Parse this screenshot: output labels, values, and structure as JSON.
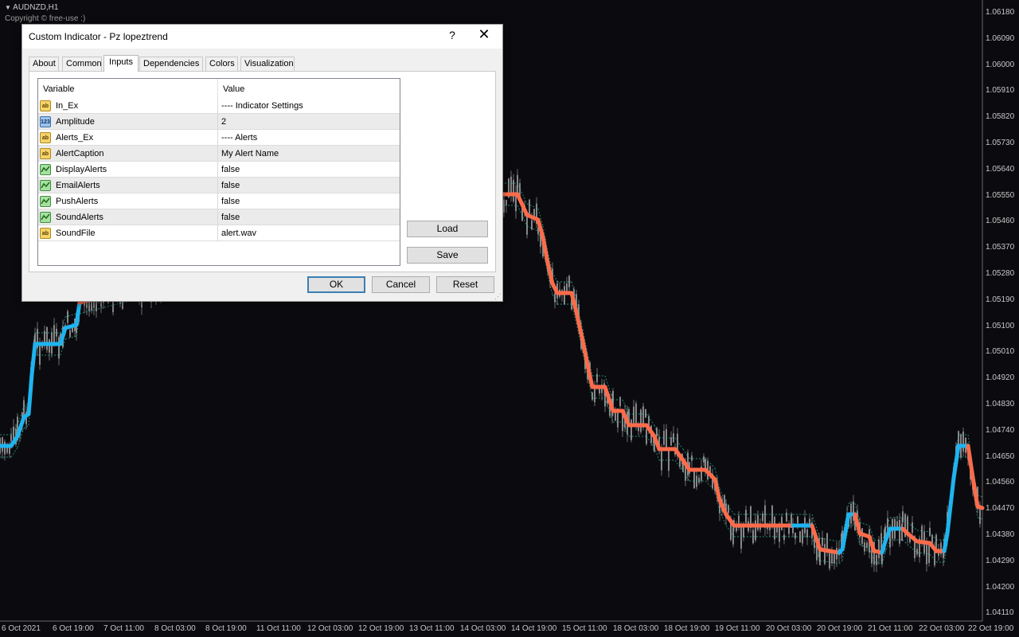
{
  "chart": {
    "symbol_label": "AUDNZD,H1",
    "copyright": "Copyright © free-use :)",
    "y_labels": [
      "1.06180",
      "1.06090",
      "1.06000",
      "1.05910",
      "1.05820",
      "1.05730",
      "1.05640",
      "1.05550",
      "1.05460",
      "1.05370",
      "1.05280",
      "1.05190",
      "1.05100",
      "1.05010",
      "1.04920",
      "1.04830",
      "1.04740",
      "1.04650",
      "1.04560",
      "1.04470",
      "1.04380",
      "1.04290",
      "1.04200",
      "1.04110"
    ],
    "x_labels": [
      "6 Oct 2021",
      "6 Oct 19:00",
      "7 Oct 11:00",
      "8 Oct 03:00",
      "8 Oct 19:00",
      "11 Oct 11:00",
      "12 Oct 03:00",
      "12 Oct 19:00",
      "13 Oct 11:00",
      "14 Oct 03:00",
      "14 Oct 19:00",
      "15 Oct 11:00",
      "18 Oct 03:00",
      "18 Oct 19:00",
      "19 Oct 11:00",
      "20 Oct 03:00",
      "20 Oct 19:00",
      "21 Oct 11:00",
      "22 Oct 03:00",
      "22 Oct 19:00"
    ],
    "colors": {
      "up": "#1eb4f0",
      "down": "#ff6b4a",
      "candles": "#9a9a9a",
      "band": "#2fb8a0"
    }
  },
  "dialog": {
    "title": "Custom Indicator - Pz lopeztrend",
    "help_label": "?",
    "close_label": "✕",
    "tabs": [
      "About",
      "Common",
      "Inputs",
      "Dependencies",
      "Colors",
      "Visualization"
    ],
    "active_tab": "Inputs",
    "grid": {
      "col_variable": "Variable",
      "col_value": "Value",
      "rows": [
        {
          "icon": "ab",
          "variable": "In_Ex",
          "value": "---- Indicator Settings"
        },
        {
          "icon": "123",
          "variable": "Amplitude",
          "value": "2"
        },
        {
          "icon": "ab",
          "variable": "Alerts_Ex",
          "value": "---- Alerts"
        },
        {
          "icon": "ab",
          "variable": "AlertCaption",
          "value": "My Alert Name"
        },
        {
          "icon": "bool",
          "variable": "DisplayAlerts",
          "value": "false"
        },
        {
          "icon": "bool",
          "variable": "EmailAlerts",
          "value": "false"
        },
        {
          "icon": "bool",
          "variable": "PushAlerts",
          "value": "false"
        },
        {
          "icon": "bool",
          "variable": "SoundAlerts",
          "value": "false"
        },
        {
          "icon": "ab",
          "variable": "SoundFile",
          "value": "alert.wav"
        }
      ]
    },
    "load_label": "Load",
    "save_label": "Save",
    "ok_label": "OK",
    "cancel_label": "Cancel",
    "reset_label": "Reset"
  }
}
